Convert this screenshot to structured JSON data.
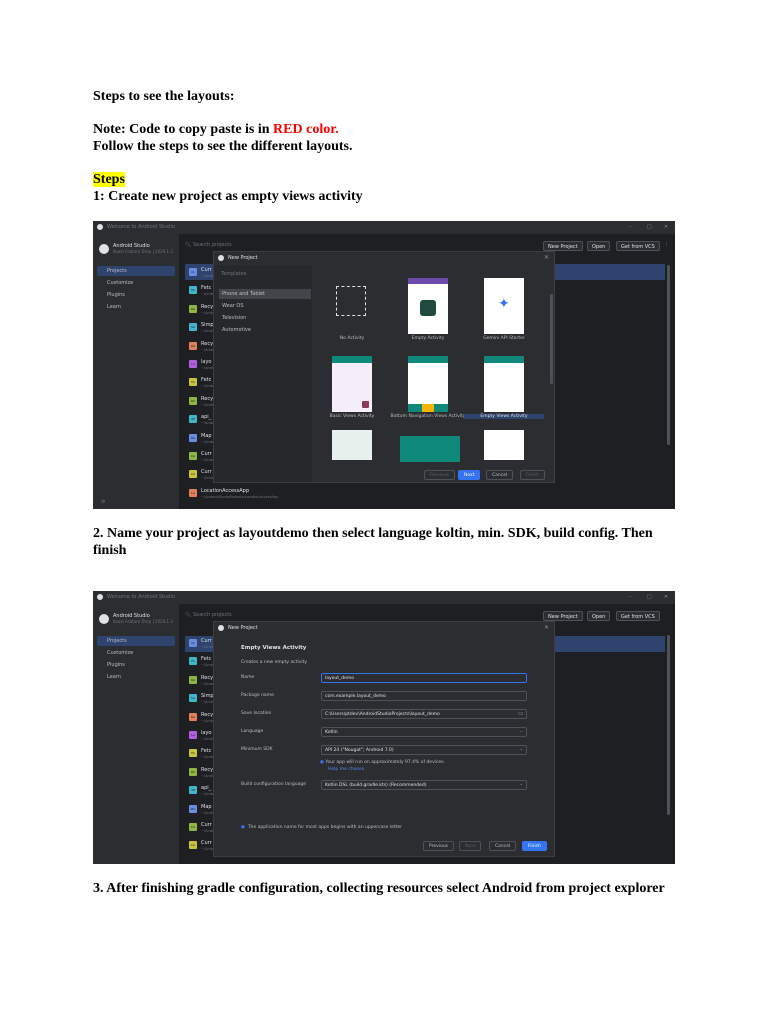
{
  "doc": {
    "heading": "Steps to see the layouts:",
    "note_prefix": "Note: Code to copy paste is in ",
    "note_red": "RED color.",
    "follow": "Follow the steps to see the different layouts.",
    "steps_label": "Steps",
    "step1": "1: Create new project as empty views activity",
    "step2": "2.  Name your project as layoutdemo then select language koltin, min. SDK, build config. Then finish",
    "step3": "3. After finishing gradle configuration, collecting resources select Android from project explorer"
  },
  "studio": {
    "window_title": "Welcome to Android Studio",
    "app_name": "Android Studio",
    "version": "Koala Feature Drop | 2024.1.2",
    "search_placeholder": "Search projects",
    "nav": [
      "Projects",
      "Customize",
      "Plugins",
      "Learn"
    ],
    "buttons": {
      "new_project": "New Project",
      "open": "Open",
      "vcs": "Get from VCS"
    },
    "projects": [
      {
        "abbr": "CL",
        "name": "Curr",
        "path": "~/AndroidStudioProjects/Curr",
        "color": "#6b8de0"
      },
      {
        "abbr": "FA",
        "name": "Fetc",
        "path": "~/AndroidStudioProjects/Fetc",
        "color": "#3fb6c9"
      },
      {
        "abbr": "RA",
        "name": "Recy",
        "path": "~/AndroidStudioProjects/Recy",
        "color": "#8fb640"
      },
      {
        "abbr": "SA",
        "name": "Simp",
        "path": "~/AndroidStudioProjects/Simp",
        "color": "#3fb6c9"
      },
      {
        "abbr": "RA",
        "name": "Recy",
        "path": "~/AndroidStudioProjects/Recy",
        "color": "#e0815b"
      },
      {
        "abbr": "LA",
        "name": "layo",
        "path": "~/AndroidStudioProjects/layo",
        "color": "#b05ee0"
      },
      {
        "abbr": "FA",
        "name": "Fetc",
        "path": "~/AndroidStudioProjects/Fetc",
        "color": "#c9c43f"
      },
      {
        "abbr": "RV",
        "name": "Recy",
        "path": "~/AndroidStudioProjects/Recy",
        "color": "#8fb640"
      },
      {
        "abbr": "AP",
        "name": "api_",
        "path": "~/AndroidStudioProjects/api_",
        "color": "#3fb6c9"
      },
      {
        "abbr": "MA",
        "name": "Map",
        "path": "~/AndroidStudioProjects/Map",
        "color": "#6b8de0"
      },
      {
        "abbr": "CA",
        "name": "Curr",
        "path": "~/AndroidStudioProjects/Curr",
        "color": "#8fb640"
      },
      {
        "abbr": "CA",
        "name": "Curr",
        "path": "~/AndroidStudioProjects/Curr",
        "color": "#c9c43f"
      }
    ],
    "last_project": {
      "abbr": "LA",
      "name": "LocationAccessApp",
      "path": "~\\AndroidStudioProjects\\LocationAccessApp",
      "color": "#e0815b"
    },
    "new_project_dialog": {
      "title": "New Project",
      "templates_header": "Templates",
      "categories": [
        "Phone and Tablet",
        "Wear OS",
        "Television",
        "Automotive"
      ],
      "tiles": [
        "No Activity",
        "Empty Activity",
        "Gemini API Starter",
        "Basic Views Activity",
        "Bottom Navigation Views Activity",
        "Empty Views Activity"
      ],
      "buttons": {
        "previous": "Previous",
        "next": "Next",
        "cancel": "Cancel",
        "finish": "Finish"
      }
    },
    "config_dialog": {
      "title": "New Project",
      "heading": "Empty Views Activity",
      "subheading": "Creates a new empty activity",
      "fields": {
        "name_label": "Name",
        "name_value": "layout_demo",
        "package_label": "Package name",
        "package_value": "com.example.layout_demo",
        "save_label": "Save location",
        "save_value": "C:\\Users\\ptdev\\AndroidStudioProjects\\layout_demo",
        "language_label": "Language",
        "language_value": "Kotlin",
        "sdk_label": "Minimum SDK",
        "sdk_value": "API 24 (\"Nougat\"; Android 7.0)",
        "sdk_info": "Your app will run on approximately 97.4% of devices.",
        "help_link": "Help me choose",
        "build_label": "Build configuration language",
        "build_value": "Kotlin DSL (build.gradle.kts) (Recommended)"
      },
      "footer_note": "The application name for most apps begins with an uppercase letter",
      "buttons": {
        "previous": "Previous",
        "next": "Next",
        "cancel": "Cancel",
        "finish": "Finish"
      }
    }
  }
}
